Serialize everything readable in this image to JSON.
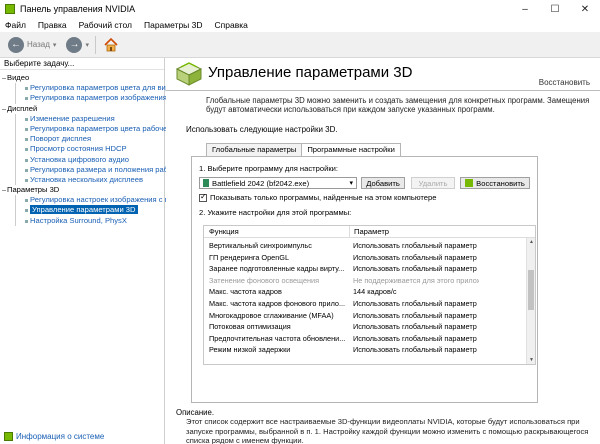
{
  "window": {
    "title": "Панель управления NVIDIA"
  },
  "menu": [
    "Файл",
    "Правка",
    "Рабочий стол",
    "Параметры 3D",
    "Справка"
  ],
  "toolbar": {
    "back_label": "Назад"
  },
  "sidebar": {
    "header": "Выберите задачу...",
    "tree": [
      {
        "label": "Видео",
        "type": "cat"
      },
      {
        "label": "Регулировка параметров цвета для вид",
        "type": "leaf"
      },
      {
        "label": "Регулировка параметров изображения д",
        "type": "leaf"
      },
      {
        "label": "Дисплей",
        "type": "cat"
      },
      {
        "label": "Изменение разрешения",
        "type": "leaf"
      },
      {
        "label": "Регулировка параметров цвета рабочег",
        "type": "leaf"
      },
      {
        "label": "Поворот дисплея",
        "type": "leaf"
      },
      {
        "label": "Просмотр состояния HDCP",
        "type": "leaf"
      },
      {
        "label": "Установка цифрового аудио",
        "type": "leaf"
      },
      {
        "label": "Регулировка размера и положения рабоч",
        "type": "leaf"
      },
      {
        "label": "Установка нескольких дисплеев",
        "type": "leaf"
      },
      {
        "label": "Параметры 3D",
        "type": "cat"
      },
      {
        "label": "Регулировка настроек изображения с пр",
        "type": "leaf"
      },
      {
        "label": "Управление параметрами 3D",
        "type": "leaf",
        "selected": true
      },
      {
        "label": "Настройка Surround, PhysX",
        "type": "leaf"
      }
    ],
    "info_link": "Информация о системе"
  },
  "main": {
    "heading": "Управление параметрами 3D",
    "restore_link": "Восстановить",
    "description": "Глобальные параметры 3D можно заменить и создать замещения для конкретных программ. Замещения будут автоматически использоваться при каждом запуске указанных программ.",
    "section_label": "Использовать следующие настройки 3D.",
    "tabs": [
      "Глобальные параметры",
      "Программные настройки"
    ],
    "step1": "1. Выберите программу для настройки:",
    "program": "Battlefield 2042 (bf2042.exe)",
    "btn_add": "Добавить",
    "btn_remove": "Удалить",
    "btn_restore": "Восстановить",
    "checkbox_label": "Показывать только программы, найденные на этом компьютере",
    "step2": "2. Укажите настройки для этой программы:",
    "table": {
      "headers": [
        "Функция",
        "Параметр"
      ],
      "rows": [
        {
          "feature": "Вертикальный синхроимпульс",
          "value": "Использовать глобальный параметр (И..."
        },
        {
          "feature": "ГП рендеринга OpenGL",
          "value": "Использовать глобальный параметр (А..."
        },
        {
          "feature": "Заранее подготовленные кадры вирту...",
          "value": "Использовать глобальный параметр (1)"
        },
        {
          "feature": "Затенение фонового освещения",
          "value": "Не поддерживается для этого приложе...",
          "disabled": true
        },
        {
          "feature": "Макс. частота кадров",
          "value": "144 кадров/с"
        },
        {
          "feature": "Макс. частота кадров фонового прило...",
          "value": "Использовать глобальный параметр (В..."
        },
        {
          "feature": "Многокадровое сглаживание (MFAA)",
          "value": "Использовать глобальный параметр (В..."
        },
        {
          "feature": "Потоковая оптимизация",
          "value": "Использовать глобальный параметр (А..."
        },
        {
          "feature": "Предпочтительная частота обновлени...",
          "value": "Использовать глобальный параметр (У..."
        },
        {
          "feature": "Режим низкой задержки",
          "value": "Использовать глобальный параметр (В..."
        }
      ]
    },
    "note_title": "Описание.",
    "note_text": "Этот список содержит все настраиваемые 3D-функции видеоплаты NVIDIA, которые будут использоваться при запуске программы, выбранной в п. 1. Настройку каждой функции можно изменить с помощью раскрывающегося списка рядом с именем функции."
  }
}
